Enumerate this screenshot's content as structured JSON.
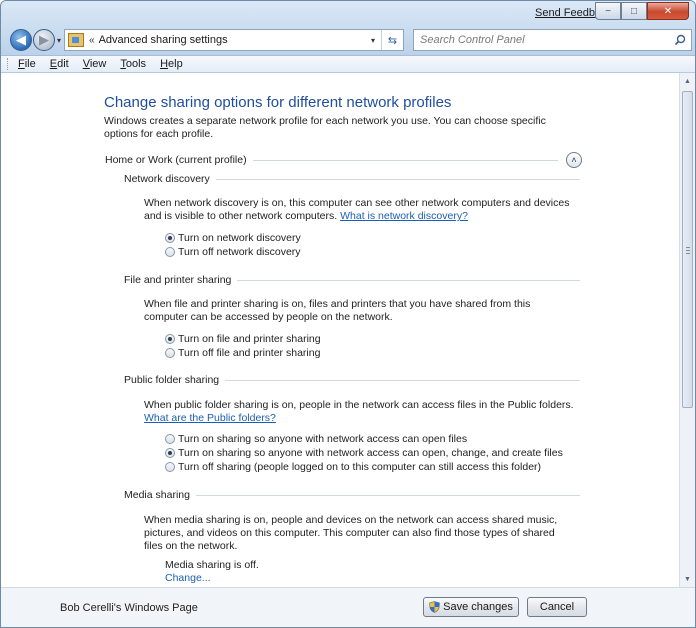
{
  "window": {
    "send_feedback": "Send Feedback",
    "minimize_glyph": "−",
    "maximize_glyph": "□",
    "close_glyph": "✕"
  },
  "nav": {
    "back_glyph": "◀",
    "forward_glyph": "▶",
    "dropdown_glyph": "▾"
  },
  "address": {
    "separator": "«",
    "path": "Advanced sharing settings",
    "dropdown_glyph": "▾",
    "refresh_glyph": "⇆"
  },
  "search": {
    "placeholder": "Search Control Panel"
  },
  "menu": [
    {
      "label": "File",
      "u": "F",
      "rest": "ile"
    },
    {
      "label": "Edit",
      "u": "E",
      "rest": "dit"
    },
    {
      "label": "View",
      "u": "V",
      "rest": "iew"
    },
    {
      "label": "Tools",
      "u": "T",
      "rest": "ools"
    },
    {
      "label": "Help",
      "u": "H",
      "rest": "elp"
    }
  ],
  "page": {
    "heading": "Change sharing options for different network profiles",
    "intro": "Windows creates a separate network profile for each network you use. You can choose specific options for each profile.",
    "profile_label": "Home or Work (current profile)",
    "collapse_glyph": "˄"
  },
  "network_discovery": {
    "title": "Network discovery",
    "desc": "When network discovery is on, this computer can see other network computers and devices and is visible to other network computers.",
    "link": "What is network discovery?",
    "options": [
      "Turn on network discovery",
      "Turn off network discovery"
    ]
  },
  "file_printer": {
    "title": "File and printer sharing",
    "desc": "When file and printer sharing is on, files and printers that you have shared from this computer can be accessed by people on the network.",
    "options": [
      "Turn on file and printer sharing",
      "Turn off file and printer sharing"
    ]
  },
  "public_folder": {
    "title": "Public folder sharing",
    "desc": "When public folder sharing is on, people in the network can access files in the Public folders.",
    "link": "What are the Public folders?",
    "options": [
      "Turn on sharing so anyone with network access can open files",
      "Turn on sharing so anyone with network access can open, change, and create files",
      "Turn off sharing (people logged on to this computer can still access this folder)"
    ]
  },
  "media_sharing": {
    "title": "Media sharing",
    "desc": "When media sharing is on, people and devices on the network can access shared music, pictures, and videos on this computer. This computer can also find those types of shared files on the network.",
    "status": "Media sharing is off.",
    "change_link": "Change..."
  },
  "footer": {
    "credit": "Bob Cerelli's Windows Page",
    "save_label": "Save changes",
    "cancel_label": "Cancel"
  }
}
